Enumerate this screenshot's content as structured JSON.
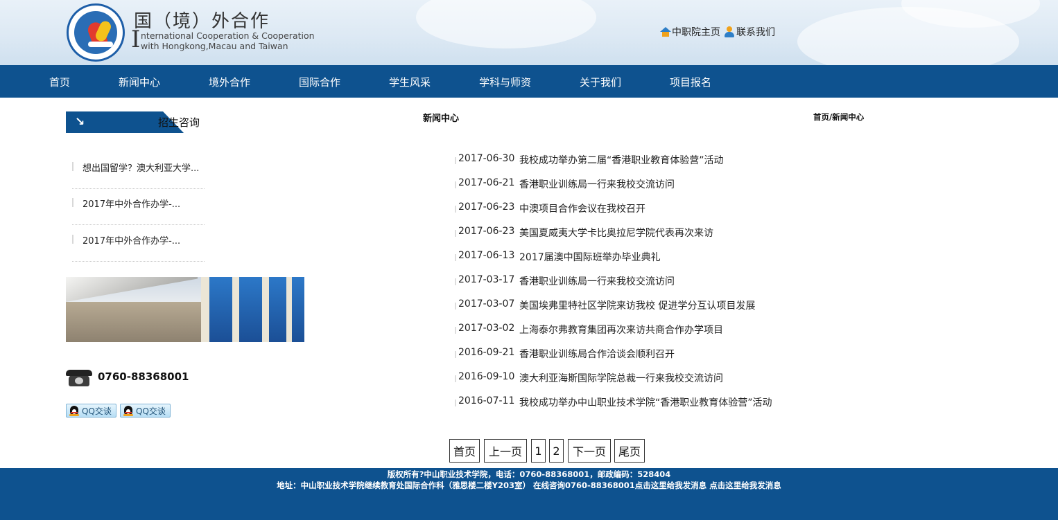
{
  "header": {
    "title_cn": "国（境）外合作",
    "title_en_initial": "I",
    "title_en_line1": "nternational Cooperation & Cooperation",
    "title_en_line2": "with  Hongkong,Macau and Taiwan",
    "links": [
      {
        "label": "中职院主页",
        "icon": "house-icon"
      },
      {
        "label": "联系我们",
        "icon": "contact-icon"
      }
    ]
  },
  "nav": {
    "items": [
      {
        "label": "首页"
      },
      {
        "label": "新闻中心"
      },
      {
        "label": "境外合作"
      },
      {
        "label": "国际合作"
      },
      {
        "label": "学生风采"
      },
      {
        "label": "学科与师资"
      },
      {
        "label": "关于我们"
      },
      {
        "label": "项目报名"
      }
    ],
    "color": "#0e528f"
  },
  "sidebar": {
    "arrow": "↘",
    "title": "招生咨询",
    "items": [
      {
        "label": "想出国留学？澳大利亚大学..."
      },
      {
        "label": "2017年中外合作办学-..."
      },
      {
        "label": "2017年中外合作办学-..."
      }
    ],
    "phone": "0760-88368001",
    "qq_buttons": [
      {
        "label": "QQ交谈"
      },
      {
        "label": "QQ交谈"
      }
    ]
  },
  "main": {
    "section_title": "新闻中心",
    "breadcrumb": "首页/新闻中心",
    "news": [
      {
        "date": "2017-06-30",
        "title": "我校成功举办第二届“香港职业教育体验营”活动"
      },
      {
        "date": "2017-06-21",
        "title": "香港职业训练局一行来我校交流访问"
      },
      {
        "date": "2017-06-23",
        "title": "中澳项目合作会议在我校召开"
      },
      {
        "date": "2017-06-23",
        "title": "美国夏威夷大学卡比奥拉尼学院代表再次来访"
      },
      {
        "date": "2017-06-13",
        "title": "2017届澳中国际班举办毕业典礼"
      },
      {
        "date": "2017-03-17",
        "title": "香港职业训练局一行来我校交流访问"
      },
      {
        "date": "2017-03-07",
        "title": "美国埃弗里特社区学院来访我校 促进学分互认项目发展"
      },
      {
        "date": "2017-03-02",
        "title": "上海泰尔弗教育集团再次来访共商合作办学项目"
      },
      {
        "date": "2016-09-21",
        "title": "香港职业训练局合作洽谈会顺利召开"
      },
      {
        "date": "2016-09-10",
        "title": "澳大利亚海斯国际学院总裁一行来我校交流访问"
      },
      {
        "date": "2016-07-11",
        "title": "我校成功举办中山职业技术学院“香港职业教育体验营”活动"
      }
    ],
    "pagination": [
      {
        "label": "首页"
      },
      {
        "label": "上一页"
      },
      {
        "label": "1"
      },
      {
        "label": "2"
      },
      {
        "label": "下一页"
      },
      {
        "label": "尾页"
      }
    ]
  },
  "footer": {
    "line1": "版权所有?中山职业技术学院，电话：0760-88368001，邮政编码：528404",
    "line2": "地址：中山职业技术学院继续教育处国际合作科（雅思楼二楼Y203室） 在线咨询0760-88368001点击这里给我发消息 点击这里给我发消息"
  }
}
